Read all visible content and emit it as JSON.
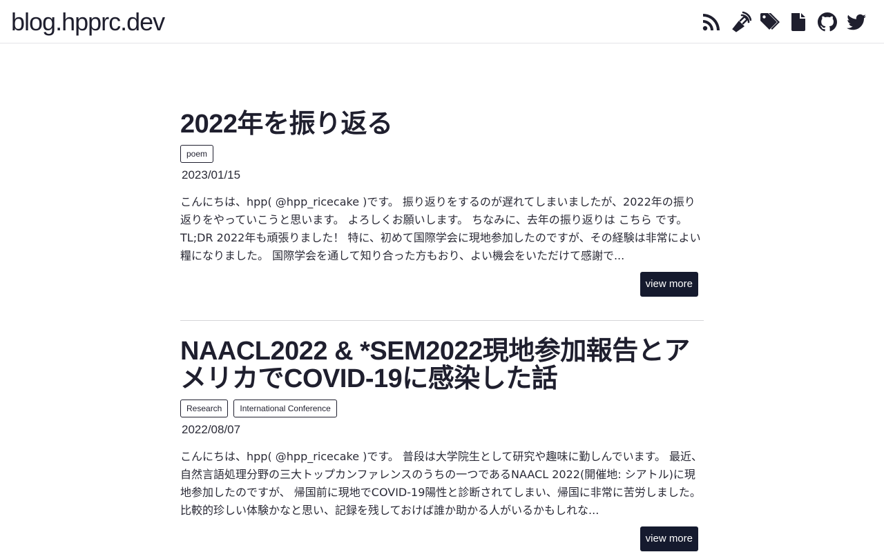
{
  "site": {
    "title": "blog.hpprc.dev"
  },
  "header_icons": [
    {
      "name": "rss-icon"
    },
    {
      "name": "pen-nib-icon"
    },
    {
      "name": "tags-icon"
    },
    {
      "name": "file-icon"
    },
    {
      "name": "github-icon"
    },
    {
      "name": "twitter-icon"
    }
  ],
  "posts": [
    {
      "title": "2022年を振り返る",
      "tags": [
        "poem"
      ],
      "date": "2023/01/15",
      "excerpt": "こんにちは、hpp( @hpp_ricecake )です。 振り返りをするのが遅れてしまいましたが、2022年の振り返りをやっていこうと思います。 よろしくお願いします。 ちなみに、去年の振り返りは こちら です。 TL;DR 2022年も頑張りました！ 特に、初めて国際学会に現地参加したのですが、その経験は非常によい糧になりました。 国際学会を通して知り合った方もおり、よい機会をいただけて感謝で...",
      "more_label": "view more"
    },
    {
      "title": "NAACL2022 & *SEM2022現地参加報告とアメリカでCOVID-19に感染した話",
      "tags": [
        "Research",
        "International Conference"
      ],
      "date": "2022/08/07",
      "excerpt": "こんにちは、hpp( @hpp_ricecake )です。 普段は大学院生として研究や趣味に勤しんでいます。 最近、自然言語処理分野の三大トップカンファレンスのうちの一つであるNAACL 2022(開催地: シアトル)に現地参加したのですが、 帰国前に現地でCOVID-19陽性と診断されてしまい、帰国に非常に苦労しました。 比較的珍しい体験かなと思い、記録を残しておけば誰か助かる人がいるかもしれな...",
      "more_label": "view more"
    }
  ]
}
